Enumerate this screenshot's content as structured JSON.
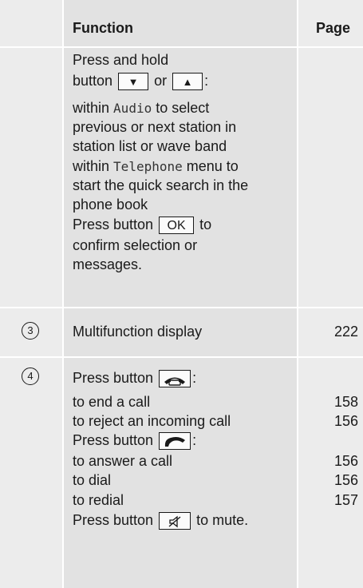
{
  "header": {
    "function": "Function",
    "page": "Page"
  },
  "block1": {
    "line1": "Press and hold",
    "line2_prefix": "button",
    "down_key": "▼",
    "or": "or",
    "up_key": "▲",
    "line2_suffix": ":",
    "audio_pre": "within",
    "audio_menu": "Audio",
    "audio_post": "to select",
    "audio_l2": "previous or next station in",
    "audio_l3": "station list or wave band",
    "tel_pre": "within",
    "tel_menu": "Telephone",
    "tel_post": "menu to",
    "tel_l2": "start the quick search in the",
    "tel_l3": "phone book",
    "ok_pre": "Press button",
    "ok_key": "OK",
    "ok_post": "to",
    "ok_l2": "confirm selection or",
    "ok_l3": "messages."
  },
  "row3": {
    "marker": "3",
    "text": "Multifunction display",
    "page": "222"
  },
  "row4": {
    "marker": "4",
    "end_pre": "Press button",
    "end_key_icon": "hang-up-phone-icon",
    "end_post": ":",
    "end_call": "to end a call",
    "end_call_page": "158",
    "reject": "to reject an incoming call",
    "reject_page": "156",
    "ans_pre": "Press button",
    "ans_key_icon": "answer-phone-icon",
    "ans_post": ":",
    "answer": "to answer a call",
    "answer_page": "156",
    "dial": "to dial",
    "dial_page": "156",
    "redial": "to redial",
    "redial_page": "157",
    "mute_pre": "Press button",
    "mute_key_icon": "mute-icon",
    "mute_post": "to mute."
  }
}
